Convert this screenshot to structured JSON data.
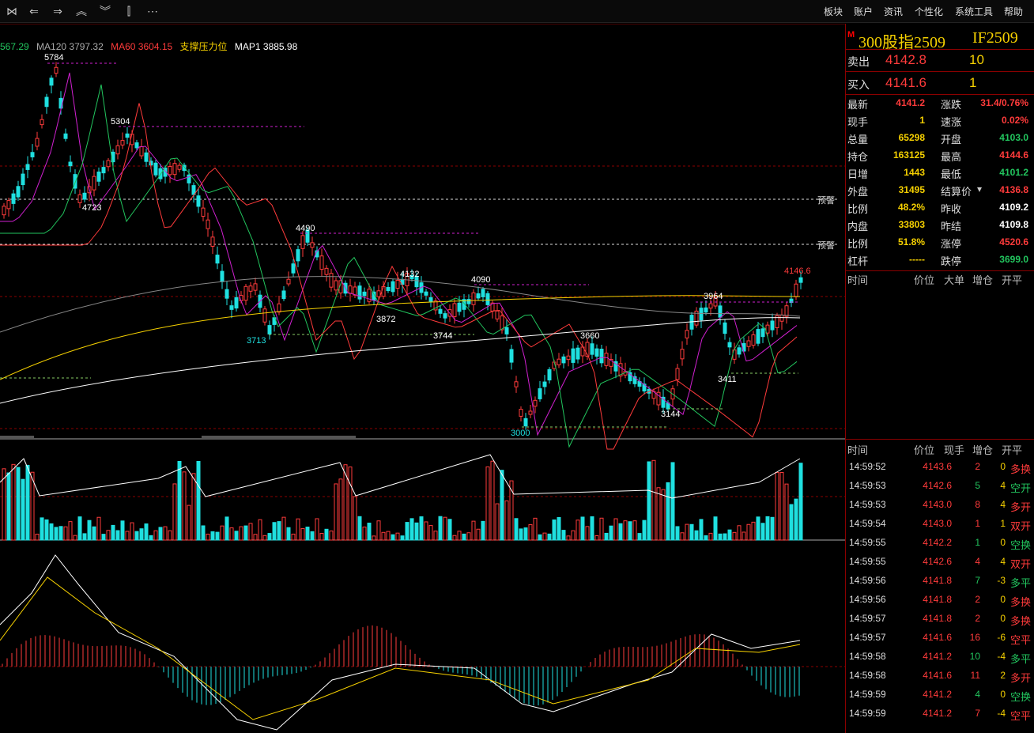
{
  "toolbar": {
    "icons": [
      "collapse-icon",
      "back-icon",
      "forward-icon",
      "up-icon",
      "down-icon",
      "chart-add-icon",
      "more-icon"
    ],
    "menu": [
      "板块",
      "账户",
      "资讯",
      "个性化",
      "系统工具",
      "帮助"
    ]
  },
  "ma_legend": [
    {
      "text": "567.29",
      "color": "#22c55e"
    },
    {
      "text": "MA120 3797.32",
      "color": "#aaaaaa"
    },
    {
      "text": "MA60 3604.15",
      "color": "#ff3b3b"
    },
    {
      "text": "支撑压力位",
      "color": "#f5d000"
    },
    {
      "text": "MAP1 3885.98",
      "color": "#ffffff"
    }
  ],
  "price_annotations": [
    "5784",
    "5304",
    "4723",
    "4490",
    "4132",
    "4090",
    "3872",
    "3744",
    "3713",
    "3660",
    "3964",
    "3411",
    "3144",
    "3000",
    "4146.6"
  ],
  "warn_labels": [
    "预警",
    "预警"
  ],
  "instrument": {
    "marker": "M",
    "name": "300股指2509",
    "code": "IF2509"
  },
  "orderbook": {
    "sell": {
      "label": "卖出",
      "price": "4142.8",
      "vol": "10"
    },
    "buy": {
      "label": "买入",
      "price": "4141.6",
      "vol": "1"
    }
  },
  "quote_rows": [
    {
      "l1": "最新",
      "v1": "4141.2",
      "c1": "#ff3b3b",
      "l2": "涨跌",
      "v2": "31.4/0.76%",
      "c2": "#ff3b3b"
    },
    {
      "l1": "现手",
      "v1": "1",
      "c1": "#f5d000",
      "l2": "速涨",
      "v2": "0.02%",
      "c2": "#ff3b3b"
    },
    {
      "l1": "总量",
      "v1": "65298",
      "c1": "#f5d000",
      "l2": "开盘",
      "v2": "4103.0",
      "c2": "#22c55e"
    },
    {
      "l1": "持仓",
      "v1": "163125",
      "c1": "#f5d000",
      "l2": "最高",
      "v2": "4144.6",
      "c2": "#ff3b3b"
    },
    {
      "l1": "日增",
      "v1": "1443",
      "c1": "#f5d000",
      "l2": "最低",
      "v2": "4101.2",
      "c2": "#22c55e"
    },
    {
      "l1": "外盘",
      "v1": "31495",
      "c1": "#f5d000",
      "l2": "结算价",
      "v2": "4136.8",
      "c2": "#ff3b3b"
    },
    {
      "l1": "比例",
      "v1": "48.2%",
      "c1": "#f5d000",
      "l2": "昨收",
      "v2": "4109.2",
      "c2": "#ffffff"
    },
    {
      "l1": "内盘",
      "v1": "33803",
      "c1": "#f5d000",
      "l2": "昨结",
      "v2": "4109.8",
      "c2": "#ffffff"
    },
    {
      "l1": "比例",
      "v1": "51.8%",
      "c1": "#f5d000",
      "l2": "涨停",
      "v2": "4520.6",
      "c2": "#ff3b3b"
    },
    {
      "l1": "杠杆",
      "v1": "-----",
      "c1": "#f5d000",
      "l2": "跌停",
      "v2": "3699.0",
      "c2": "#22c55e"
    }
  ],
  "bigorder_header": [
    "时间",
    "价位",
    "大单",
    "增仓",
    "开平"
  ],
  "trades_header": [
    "时间",
    "价位",
    "现手",
    "增仓",
    "开平"
  ],
  "trades": [
    {
      "t": "14:59:52",
      "p": "4143.6",
      "q": "2",
      "d": "0",
      "k": "多换",
      "pc": "#ff3b3b",
      "qc": "#ff3b3b",
      "dc": "#f5d000",
      "kc": "#ff3b3b"
    },
    {
      "t": "14:59:53",
      "p": "4142.6",
      "q": "5",
      "d": "4",
      "k": "空开",
      "pc": "#ff3b3b",
      "qc": "#22c55e",
      "dc": "#f5d000",
      "kc": "#22c55e"
    },
    {
      "t": "14:59:53",
      "p": "4143.0",
      "q": "8",
      "d": "4",
      "k": "多开",
      "pc": "#ff3b3b",
      "qc": "#ff3b3b",
      "dc": "#f5d000",
      "kc": "#ff3b3b"
    },
    {
      "t": "14:59:54",
      "p": "4143.0",
      "q": "1",
      "d": "1",
      "k": "双开",
      "pc": "#ff3b3b",
      "qc": "#ff3b3b",
      "dc": "#f5d000",
      "kc": "#ff3b3b"
    },
    {
      "t": "14:59:55",
      "p": "4142.2",
      "q": "1",
      "d": "0",
      "k": "空换",
      "pc": "#ff3b3b",
      "qc": "#22c55e",
      "dc": "#f5d000",
      "kc": "#22c55e"
    },
    {
      "t": "14:59:55",
      "p": "4142.6",
      "q": "4",
      "d": "4",
      "k": "双开",
      "pc": "#ff3b3b",
      "qc": "#ff3b3b",
      "dc": "#f5d000",
      "kc": "#ff3b3b"
    },
    {
      "t": "14:59:56",
      "p": "4141.8",
      "q": "7",
      "d": "-3",
      "k": "多平",
      "pc": "#ff3b3b",
      "qc": "#22c55e",
      "dc": "#f5d000",
      "kc": "#22c55e"
    },
    {
      "t": "14:59:56",
      "p": "4141.8",
      "q": "2",
      "d": "0",
      "k": "多换",
      "pc": "#ff3b3b",
      "qc": "#ff3b3b",
      "dc": "#f5d000",
      "kc": "#ff3b3b"
    },
    {
      "t": "14:59:57",
      "p": "4141.8",
      "q": "2",
      "d": "0",
      "k": "多换",
      "pc": "#ff3b3b",
      "qc": "#ff3b3b",
      "dc": "#f5d000",
      "kc": "#ff3b3b"
    },
    {
      "t": "14:59:57",
      "p": "4141.6",
      "q": "16",
      "d": "-6",
      "k": "空平",
      "pc": "#ff3b3b",
      "qc": "#ff3b3b",
      "dc": "#f5d000",
      "kc": "#ff3b3b"
    },
    {
      "t": "14:59:58",
      "p": "4141.2",
      "q": "10",
      "d": "-4",
      "k": "多平",
      "pc": "#ff3b3b",
      "qc": "#22c55e",
      "dc": "#f5d000",
      "kc": "#22c55e"
    },
    {
      "t": "14:59:58",
      "p": "4141.6",
      "q": "11",
      "d": "2",
      "k": "多开",
      "pc": "#ff3b3b",
      "qc": "#ff3b3b",
      "dc": "#f5d000",
      "kc": "#ff3b3b"
    },
    {
      "t": "14:59:59",
      "p": "4141.2",
      "q": "4",
      "d": "0",
      "k": "空换",
      "pc": "#ff3b3b",
      "qc": "#22c55e",
      "dc": "#f5d000",
      "kc": "#22c55e"
    },
    {
      "t": "14:59:59",
      "p": "4141.2",
      "q": "7",
      "d": "-4",
      "k": "空平",
      "pc": "#ff3b3b",
      "qc": "#ff3b3b",
      "dc": "#f5d000",
      "kc": "#ff3b3b"
    }
  ],
  "colors": {
    "up": "#ff3b3b",
    "down": "#1fe0e0",
    "frame": "#8b0000",
    "accent": "#f5d000"
  }
}
